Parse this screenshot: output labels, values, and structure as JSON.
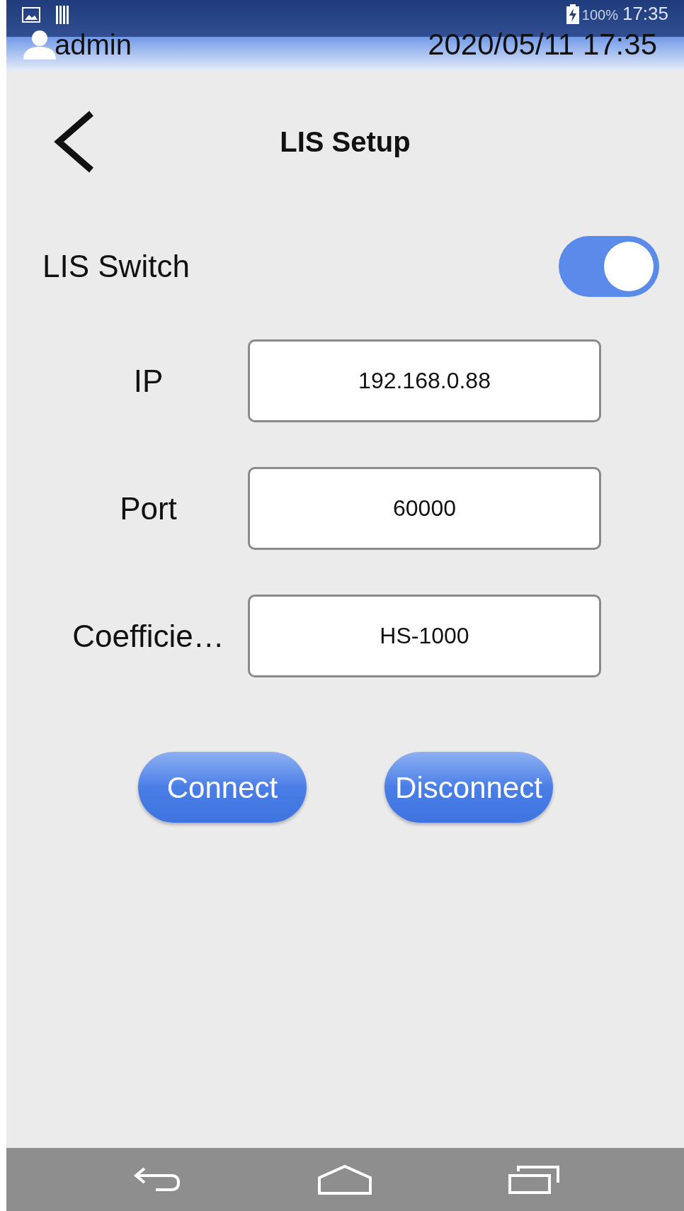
{
  "status_bar": {
    "battery": "100%",
    "time": "17:35"
  },
  "header": {
    "user": "admin",
    "datetime": "2020/05/11 17:35"
  },
  "title": "LIS Setup",
  "switch": {
    "label": "LIS Switch",
    "on": true
  },
  "fields": [
    {
      "label": "IP",
      "value": "192.168.0.88"
    },
    {
      "label": "Port",
      "value": "60000"
    },
    {
      "label": "Coefficie…",
      "value": "HS-1000"
    }
  ],
  "buttons": [
    "Connect",
    "Disconnect"
  ]
}
